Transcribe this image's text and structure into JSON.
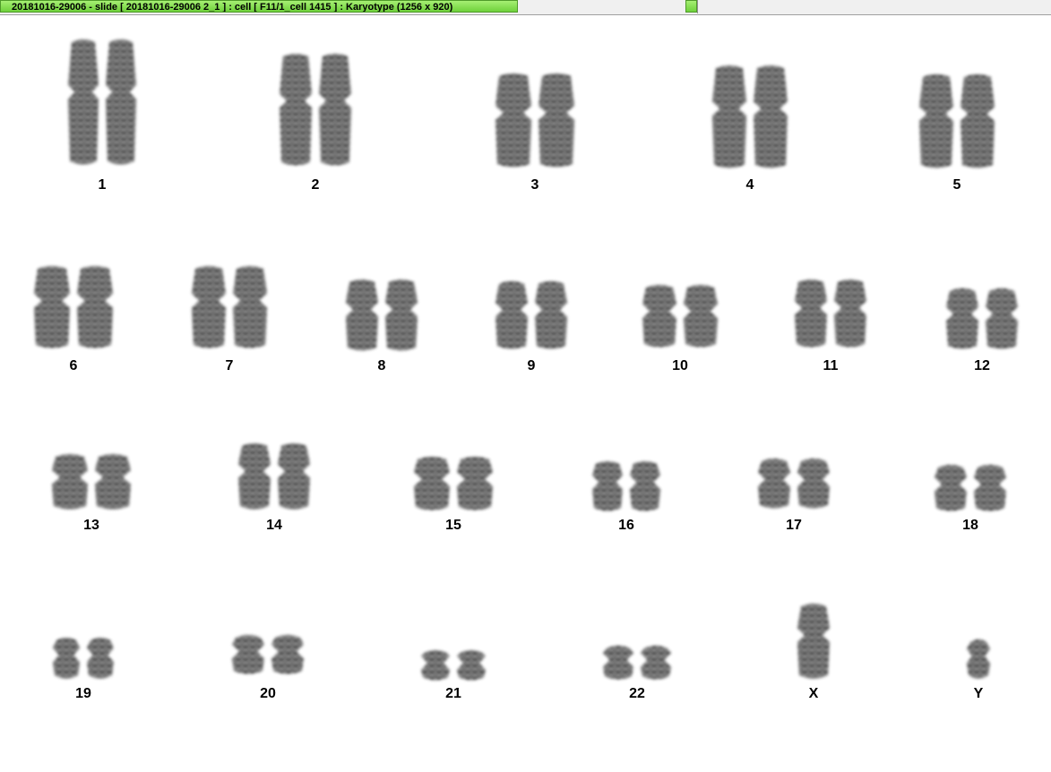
{
  "window": {
    "title": "20181016-29006 - slide [ 20181016-29006 2_1 ] : cell [ F11/1_cell 1415 ] : Karyotype  (1256 x 920)"
  },
  "karyotype": {
    "chromosomes": [
      {
        "id": "1"
      },
      {
        "id": "2"
      },
      {
        "id": "3"
      },
      {
        "id": "4"
      },
      {
        "id": "5"
      },
      {
        "id": "6"
      },
      {
        "id": "7"
      },
      {
        "id": "8"
      },
      {
        "id": "9"
      },
      {
        "id": "10"
      },
      {
        "id": "11"
      },
      {
        "id": "12"
      },
      {
        "id": "13"
      },
      {
        "id": "14"
      },
      {
        "id": "15"
      },
      {
        "id": "16"
      },
      {
        "id": "17"
      },
      {
        "id": "18"
      },
      {
        "id": "19"
      },
      {
        "id": "20"
      },
      {
        "id": "21"
      },
      {
        "id": "22"
      },
      {
        "id": "X"
      },
      {
        "id": "Y"
      }
    ]
  }
}
